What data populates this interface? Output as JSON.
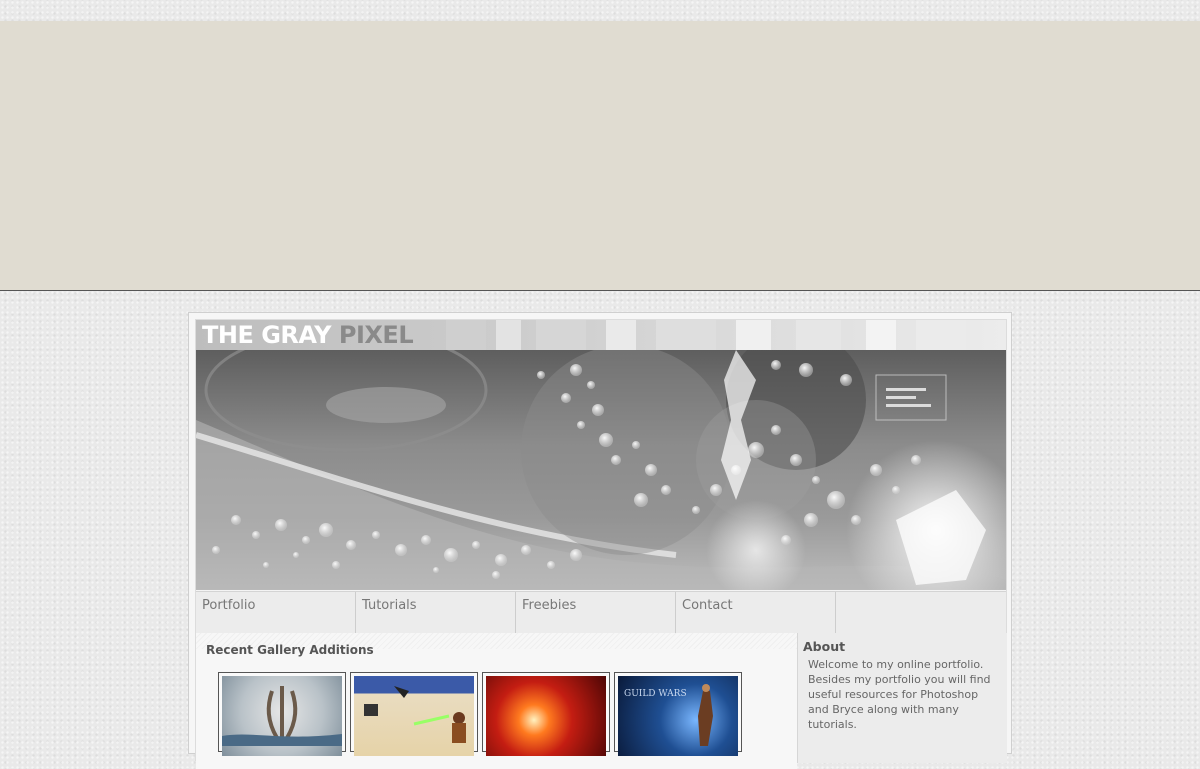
{
  "site": {
    "logo_part1": "THE GRAY",
    "logo_part2": "PIXEL"
  },
  "nav": {
    "items": [
      {
        "label": "Portfolio"
      },
      {
        "label": "Tutorials"
      },
      {
        "label": "Freebies"
      },
      {
        "label": "Contact"
      }
    ]
  },
  "main": {
    "section_title": "Recent Gallery Additions",
    "thumbnails": [
      {
        "subject": "oblivion-emblem"
      },
      {
        "subject": "lightsaber-desert-scene"
      },
      {
        "subject": "red-explosion"
      },
      {
        "subject": "guild-wars-character"
      }
    ]
  },
  "sidebar": {
    "about_title": "About",
    "about_text": "Welcome to my online portfolio. Besides my portfolio you will find useful resources for Photoshop and Bryce along with many tutorials."
  },
  "colors": {
    "top_band": "#e0dcd1",
    "page_bg": "#e9e9e9",
    "nav_text": "#777777",
    "logo_white": "#ffffff",
    "logo_gray": "#8a8a8a"
  }
}
